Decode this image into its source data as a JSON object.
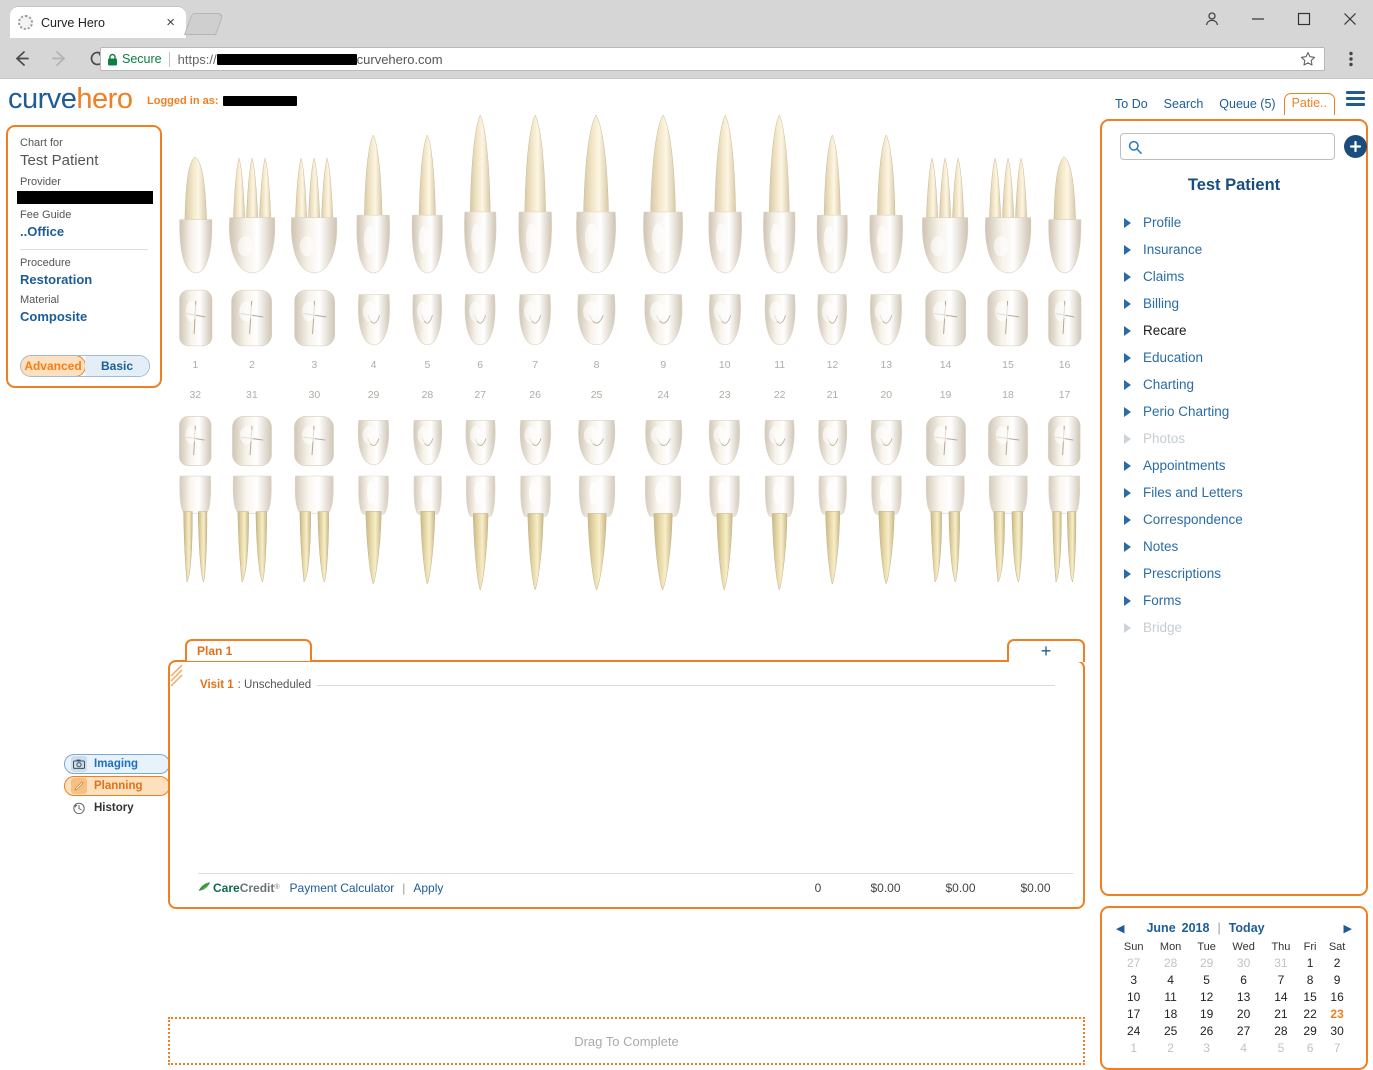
{
  "browser": {
    "tab_title": "Curve Hero",
    "tab_close_label": "×",
    "secure_label": "Secure",
    "url_scheme": "https://",
    "url_visible_tail": "curvehero.com"
  },
  "app_header": {
    "logo_part1": "curve",
    "logo_part2": "hero",
    "logged_in_as": "Logged in as:",
    "nav": [
      {
        "label": "To Do",
        "active": false
      },
      {
        "label": "Search",
        "active": false
      },
      {
        "label": "Queue (5)",
        "active": false
      },
      {
        "label": "Patie..",
        "active": true
      }
    ]
  },
  "info_card": {
    "chart_for_label": "Chart for",
    "patient_name": "Test Patient",
    "provider_label": "Provider",
    "fee_guide_label": "Fee Guide",
    "fee_guide_value": "..Office",
    "procedure_label": "Procedure",
    "procedure_value": "Restoration",
    "material_label": "Material",
    "material_value": "Composite",
    "mode_advanced": "Advanced",
    "mode_basic": "Basic",
    "mode_selected": "Advanced"
  },
  "odontogram": {
    "upper_numbers": [
      "1",
      "2",
      "3",
      "4",
      "5",
      "6",
      "7",
      "8",
      "9",
      "10",
      "11",
      "12",
      "13",
      "14",
      "15",
      "16"
    ],
    "lower_numbers": [
      "32",
      "31",
      "30",
      "29",
      "28",
      "27",
      "26",
      "25",
      "24",
      "23",
      "22",
      "21",
      "20",
      "19",
      "18",
      "17"
    ]
  },
  "tool_tabs": [
    {
      "label": "Imaging",
      "icon": "camera-icon",
      "state": "normal"
    },
    {
      "label": "Planning",
      "icon": "pencil-icon",
      "state": "selected"
    },
    {
      "label": "History",
      "icon": "history-clock-icon",
      "state": "plain"
    }
  ],
  "plan": {
    "tab_label": "Plan 1",
    "add_plan_label": "+",
    "visit_label": "Visit 1",
    "visit_status": ": Unscheduled",
    "carecredit_care": "Care",
    "carecredit_credit": "Credit",
    "carecredit_tm": "®",
    "payment_calculator": "Payment Calculator",
    "separator": "|",
    "apply": "Apply",
    "total_count": "0",
    "total_fee": "$0.00",
    "total_insurance": "$0.00",
    "total_patient": "$0.00"
  },
  "drag_zone": {
    "label": "Drag To Complete"
  },
  "right_panel": {
    "search_placeholder": "",
    "search_value": "",
    "add_label": "+",
    "patient_name": "Test Patient",
    "items": [
      {
        "label": "Profile",
        "state": "link"
      },
      {
        "label": "Insurance",
        "state": "link"
      },
      {
        "label": "Claims",
        "state": "link"
      },
      {
        "label": "Billing",
        "state": "link"
      },
      {
        "label": "Recare",
        "state": "dark"
      },
      {
        "label": "Education",
        "state": "link"
      },
      {
        "label": "Charting",
        "state": "link"
      },
      {
        "label": "Perio Charting",
        "state": "link"
      },
      {
        "label": "Photos",
        "state": "disabled"
      },
      {
        "label": "Appointments",
        "state": "link"
      },
      {
        "label": "Files and Letters",
        "state": "link"
      },
      {
        "label": "Correspondence",
        "state": "link"
      },
      {
        "label": "Notes",
        "state": "link"
      },
      {
        "label": "Prescriptions",
        "state": "link"
      },
      {
        "label": "Forms",
        "state": "link"
      },
      {
        "label": "Bridge",
        "state": "disabled"
      }
    ]
  },
  "calendar": {
    "prev_label": "◀",
    "next_label": "▶",
    "month": "June",
    "year": "2018",
    "pipe": "|",
    "today_label": "Today",
    "weekdays": [
      "Sun",
      "Mon",
      "Tue",
      "Wed",
      "Thu",
      "Fri",
      "Sat"
    ],
    "weeks": [
      [
        {
          "d": "27",
          "m": true
        },
        {
          "d": "28",
          "m": true
        },
        {
          "d": "29",
          "m": true
        },
        {
          "d": "30",
          "m": true
        },
        {
          "d": "31",
          "m": true
        },
        {
          "d": "1",
          "m": false
        },
        {
          "d": "2",
          "m": false
        }
      ],
      [
        {
          "d": "3",
          "m": false
        },
        {
          "d": "4",
          "m": false
        },
        {
          "d": "5",
          "m": false
        },
        {
          "d": "6",
          "m": false
        },
        {
          "d": "7",
          "m": false
        },
        {
          "d": "8",
          "m": false
        },
        {
          "d": "9",
          "m": false
        }
      ],
      [
        {
          "d": "10",
          "m": false
        },
        {
          "d": "11",
          "m": false
        },
        {
          "d": "12",
          "m": false
        },
        {
          "d": "13",
          "m": false
        },
        {
          "d": "14",
          "m": false
        },
        {
          "d": "15",
          "m": false
        },
        {
          "d": "16",
          "m": false
        }
      ],
      [
        {
          "d": "17",
          "m": false
        },
        {
          "d": "18",
          "m": false
        },
        {
          "d": "19",
          "m": false
        },
        {
          "d": "20",
          "m": false
        },
        {
          "d": "21",
          "m": false
        },
        {
          "d": "22",
          "m": false
        },
        {
          "d": "23",
          "m": false,
          "today": true
        }
      ],
      [
        {
          "d": "24",
          "m": false
        },
        {
          "d": "25",
          "m": false
        },
        {
          "d": "26",
          "m": false
        },
        {
          "d": "27",
          "m": false
        },
        {
          "d": "28",
          "m": false
        },
        {
          "d": "29",
          "m": false
        },
        {
          "d": "30",
          "m": false
        }
      ],
      [
        {
          "d": "1",
          "m": true
        },
        {
          "d": "2",
          "m": true
        },
        {
          "d": "3",
          "m": true
        },
        {
          "d": "4",
          "m": true
        },
        {
          "d": "5",
          "m": true
        },
        {
          "d": "6",
          "m": true
        },
        {
          "d": "7",
          "m": true
        }
      ]
    ]
  },
  "colors": {
    "accent_orange": "#f07f22",
    "brand_blue": "#1d5c96",
    "link_blue": "#2a6ca5",
    "disabled_grey": "#c5cdd3"
  }
}
